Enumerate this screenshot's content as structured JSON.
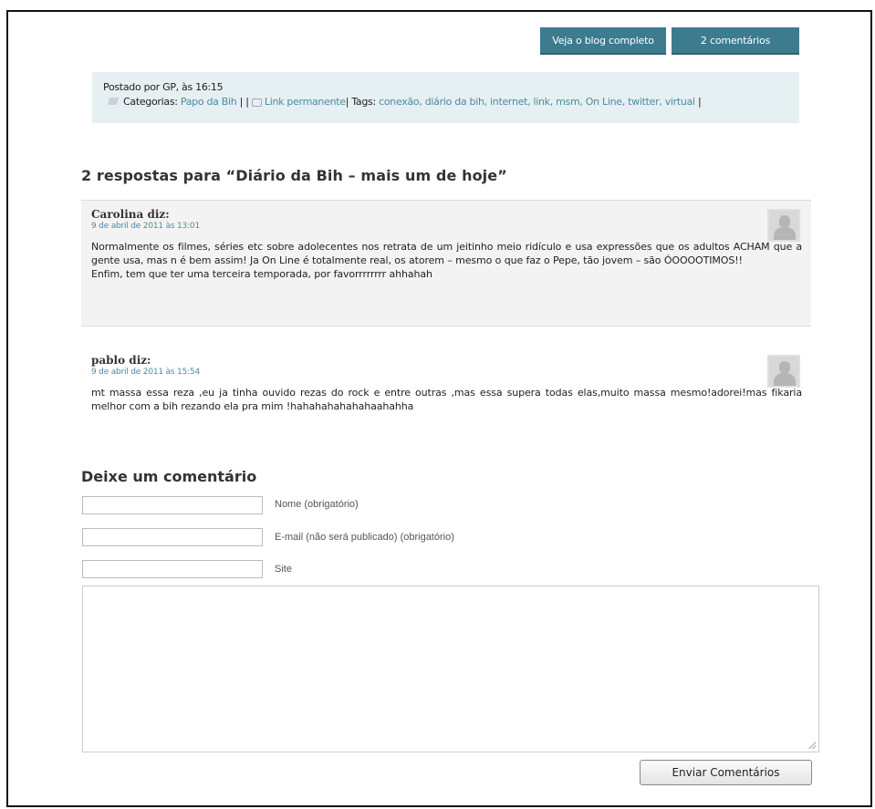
{
  "top_buttons": {
    "blog": "Veja o blog completo",
    "comments": "2 comentários"
  },
  "post_meta": {
    "posted_by": "Postado por GP, às 16:15",
    "categories_label": "Categorias:",
    "category": "Papo da Bih",
    "pipes": " | | ",
    "permalink": "Link permanente",
    "tags_prefix": "| Tags:",
    "tags": "conexão, diário da bih, internet, link, msm, On Line, twitter, virtual",
    "trailing": " |"
  },
  "responses_heading": "2 respostas para “Diário da Bih – mais um de hoje”",
  "comments": [
    {
      "author": "Carolina diz:",
      "date": "9 de abril de 2011 às 13:01",
      "body_1": "Normalmente os filmes, séries etc sobre adolecentes nos retrata de um jeitinho meio ridículo e usa expressões que os adultos ACHAM que a gente usa, mas n é bem assim! Ja On Line é totalmente real, os atorem – mesmo o que faz o Pepe, tão jovem – são ÓOOOOTIMOS!!",
      "body_2": "Enfim, tem que ter uma terceira temporada, por favorrrrrrrr ahhahah"
    },
    {
      "author": "pablo diz:",
      "date": "9 de abril de 2011 às 15:54",
      "body_1": "mt massa essa reza ,eu ja tinha ouvido rezas do rock e entre outras ,mas essa supera todas elas,muito massa mesmo!adorei!mas fikaria melhor com a bih rezando ela pra mim !hahahahahahahaahahha",
      "body_2": ""
    }
  ],
  "leave_comment": {
    "heading": "Deixe um comentário",
    "name_label": "Nome (obrigatório)",
    "email_label": "E-mail (não será publicado) (obrigatório)",
    "site_label": "Site",
    "submit": "Enviar Comentários"
  },
  "colors": {
    "button_bg": "#3d7b8f",
    "link": "#4a8ca0",
    "meta_bg": "#e6eff2"
  }
}
